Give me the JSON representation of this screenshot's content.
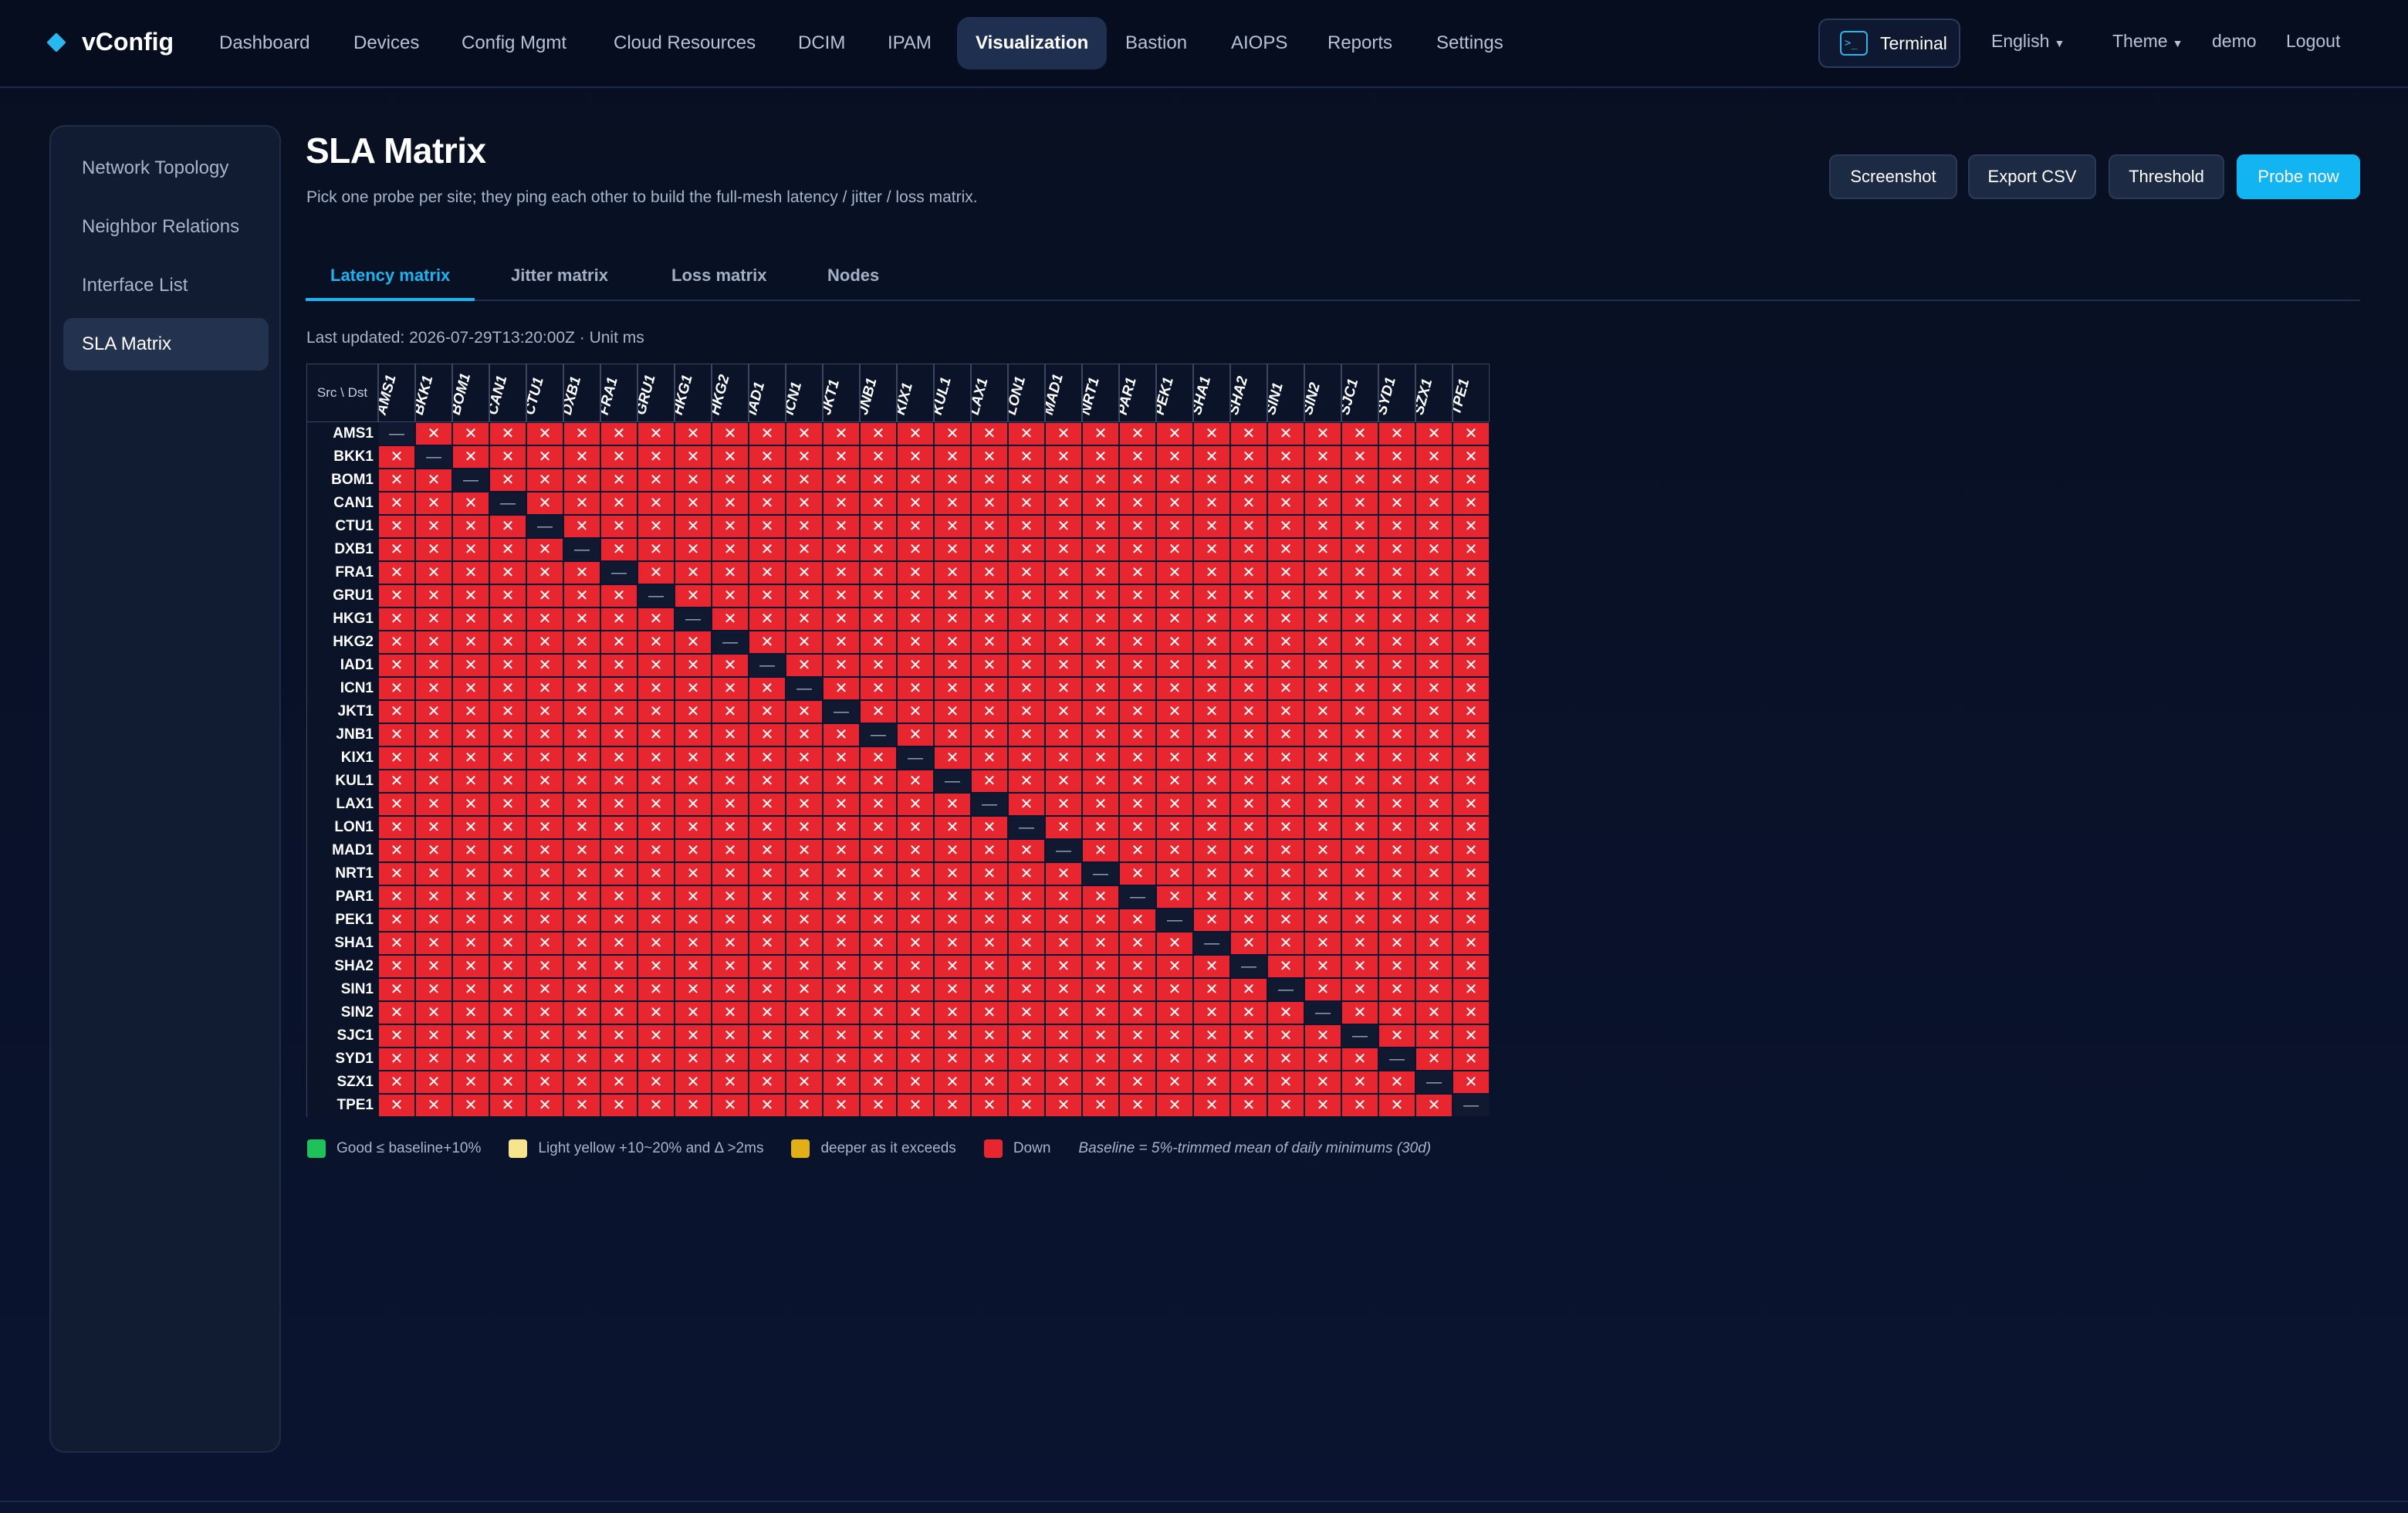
{
  "app": {
    "name": "vConfig"
  },
  "nav": {
    "items": [
      "Dashboard",
      "Devices",
      "Config Mgmt",
      "Cloud Resources",
      "DCIM",
      "IPAM",
      "Visualization",
      "Bastion",
      "AIOPS",
      "Reports",
      "Settings"
    ],
    "active": "Visualization"
  },
  "topbar": {
    "terminal": "Terminal",
    "language": "English",
    "theme": "Theme",
    "user": "demo",
    "logout": "Logout"
  },
  "sidebar": {
    "items": [
      "Network Topology",
      "Neighbor Relations",
      "Interface List",
      "SLA Matrix"
    ],
    "active": "SLA Matrix"
  },
  "page": {
    "title": "SLA Matrix",
    "subtitle": "Pick one probe per site; they ping each other to build the full-mesh latency / jitter / loss matrix.",
    "actions": {
      "screenshot": "Screenshot",
      "export": "Export CSV",
      "threshold": "Threshold",
      "probe": "Probe now"
    },
    "tabs": [
      "Latency matrix",
      "Jitter matrix",
      "Loss matrix",
      "Nodes"
    ],
    "active_tab": "Latency matrix",
    "updated": "Last updated: 2026-07-29T13:20:00Z · Unit ms"
  },
  "matrix": {
    "corner": "Src \\ Dst",
    "sites": [
      "AMS1",
      "BKK1",
      "BOM1",
      "CAN1",
      "CTU1",
      "DXB1",
      "FRA1",
      "GRU1",
      "HKG1",
      "HKG2",
      "IAD1",
      "ICN1",
      "JKT1",
      "JNB1",
      "KIX1",
      "KUL1",
      "LAX1",
      "LON1",
      "MAD1",
      "NRT1",
      "PAR1",
      "PEK1",
      "SHA1",
      "SHA2",
      "SIN1",
      "SIN2",
      "SJC1",
      "SYD1",
      "SZX1",
      "TPE1"
    ],
    "down_symbol": "✕",
    "self_symbol": "—",
    "state": "all down (off-diagonal), self on diagonal",
    "colors": {
      "down": "#e8262f",
      "self": "#10192f"
    }
  },
  "legend": {
    "good": "Good ≤ baseline+10%",
    "light_yellow": "Light yellow +10~20% and Δ >2ms",
    "deeper": "deeper as it exceeds",
    "down": "Down",
    "baseline_note": "Baseline = 5%-trimmed mean of daily minimums (30d)",
    "colors": {
      "good": "#1fc25a",
      "light_yellow": "#f6e58d",
      "deeper": "#e2b016",
      "down": "#e8262f"
    }
  }
}
